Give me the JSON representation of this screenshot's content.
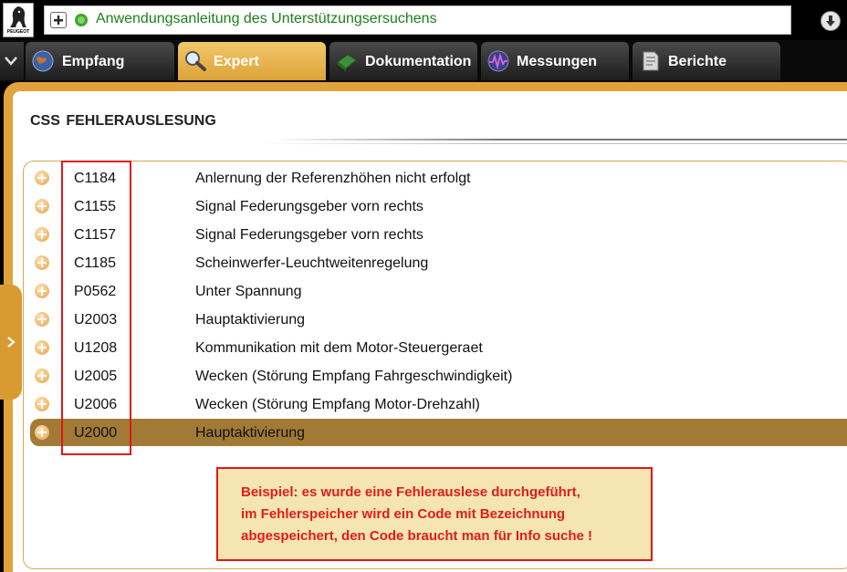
{
  "header": {
    "brand": "PEUGEOT",
    "title": "Anwendungsanleitung des Unterstützungsersuchens"
  },
  "tabs": [
    {
      "label": "Empfang",
      "icon": "globe-icon"
    },
    {
      "label": "Expert",
      "icon": "magnifier-icon"
    },
    {
      "label": "Dokumentation",
      "icon": "book-icon"
    },
    {
      "label": "Messungen",
      "icon": "waveform-icon"
    },
    {
      "label": "Berichte",
      "icon": "document-icon"
    }
  ],
  "page": {
    "title": "CSS  FEHLERAUSLESUNG"
  },
  "faults": [
    {
      "code": "C1184",
      "desc": "Anlernung der Referenzhöhen nicht erfolgt"
    },
    {
      "code": "C1155",
      "desc": "Signal Federungsgeber vorn rechts"
    },
    {
      "code": "C1157",
      "desc": "Signal Federungsgeber vorn rechts"
    },
    {
      "code": "C1185",
      "desc": "Scheinwerfer-Leuchtweitenregelung"
    },
    {
      "code": "P0562",
      "desc": "Unter Spannung"
    },
    {
      "code": "U2003",
      "desc": "Hauptaktivierung"
    },
    {
      "code": "U1208",
      "desc": "Kommunikation mit dem Motor-Steuergeraet"
    },
    {
      "code": "U2005",
      "desc": "Wecken (Störung Empfang Fahrgeschwindigkeit)"
    },
    {
      "code": "U2006",
      "desc": "Wecken (Störung Empfang Motor-Drehzahl)"
    },
    {
      "code": "U2000",
      "desc": "Hauptaktivierung",
      "selected": true
    }
  ],
  "note": {
    "line1": "Beispiel: es wurde eine Fehlerauslese durchgeführt,",
    "line2": "im Fehlerspeicher wird ein Code mit Bezeichnung",
    "line3": "abgespeichert, den Code braucht man für Info suche !"
  },
  "colors": {
    "accent": "#e0a33c",
    "selected_row": "#a17a36",
    "title_green": "#1a7f1a",
    "annotation_red": "#e01818",
    "note_bg": "#f4e5b2"
  }
}
